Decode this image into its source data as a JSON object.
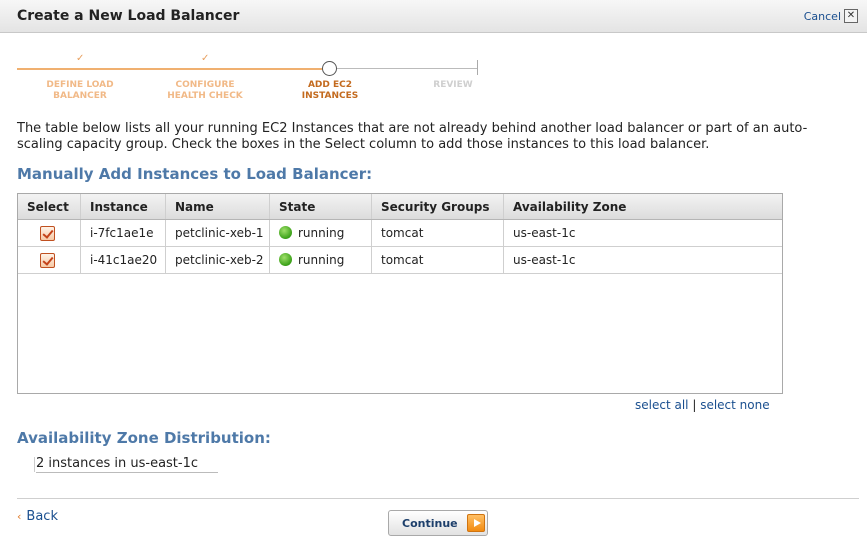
{
  "dialog": {
    "title": "Create a New Load Balancer",
    "cancel_label": "Cancel",
    "close_glyph": "✕"
  },
  "wizard": {
    "steps": [
      {
        "label": "DEFINE LOAD\nBALANCER",
        "state": "done"
      },
      {
        "label": "CONFIGURE\nHEALTH CHECK",
        "state": "done"
      },
      {
        "label": "ADD EC2\nINSTANCES",
        "state": "current"
      },
      {
        "label": "REVIEW",
        "state": "todo"
      }
    ],
    "check_glyph": "✓"
  },
  "intro_text": "The table below lists all your running EC2 Instances that are not already behind another load balancer or part of an auto-scaling capacity group. Check the boxes in the Select column to add those instances to this load balancer.",
  "manual_section": {
    "title": "Manually Add Instances to Load Balancer:"
  },
  "instances_table": {
    "columns": [
      "Select",
      "Instance",
      "Name",
      "State",
      "Security Groups",
      "Availability Zone"
    ],
    "rows": [
      {
        "selected": true,
        "instance": "i-7fc1ae1e",
        "name": "petclinic-xeb-1",
        "state": "running",
        "security_groups": "tomcat",
        "availability_zone": "us-east-1c"
      },
      {
        "selected": true,
        "instance": "i-41c1ae20",
        "name": "petclinic-xeb-2",
        "state": "running",
        "security_groups": "tomcat",
        "availability_zone": "us-east-1c"
      }
    ],
    "status_color": "#3aa018"
  },
  "selection_links": {
    "select_all": "select all",
    "separator": "|",
    "select_none": "select none"
  },
  "az_section": {
    "title": "Availability Zone Distribution:",
    "summary": "2 instances in us-east-1c"
  },
  "footer": {
    "back_glyph": "‹",
    "back_label": "Back",
    "continue_label": "Continue"
  },
  "colors": {
    "accent_orange": "#f28b12",
    "section_title_blue": "#4e79a8",
    "link_blue": "#1a4f8f"
  }
}
